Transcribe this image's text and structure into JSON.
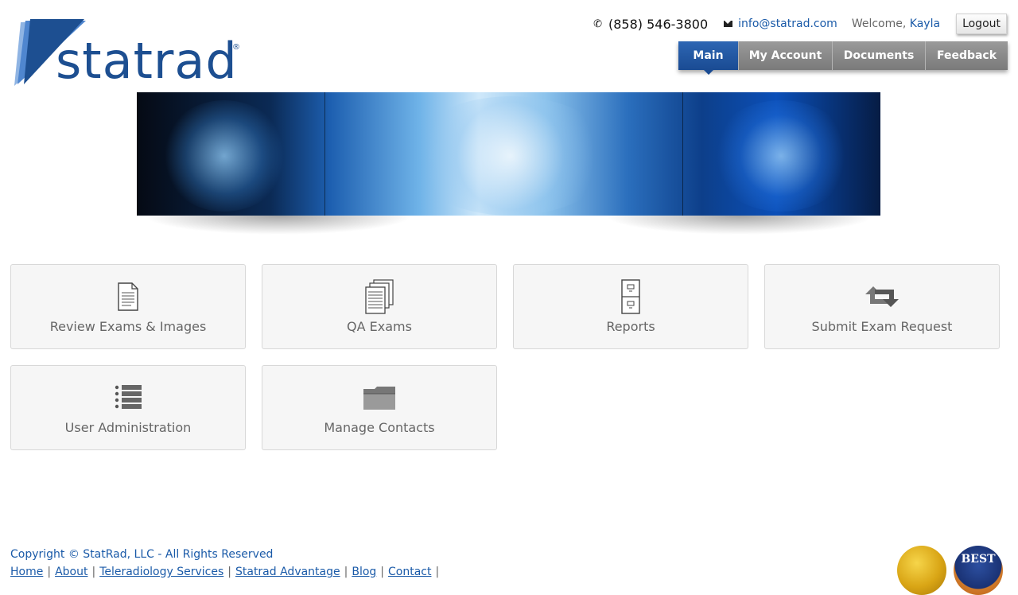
{
  "header": {
    "logo_text": "statrad",
    "logo_reg": "®",
    "phone": "(858) 546-3800",
    "email": "info@statrad.com",
    "welcome_prefix": "Welcome,",
    "user_name": "Kayla",
    "logout_label": "Logout"
  },
  "nav": {
    "tabs": [
      {
        "label": "Main",
        "active": true
      },
      {
        "label": "My Account"
      },
      {
        "label": "Documents"
      },
      {
        "label": "Feedback"
      }
    ]
  },
  "tiles": [
    {
      "label": "Review Exams & Images",
      "icon": "document-icon"
    },
    {
      "label": "QA Exams",
      "icon": "stacked-documents-icon"
    },
    {
      "label": "Reports",
      "icon": "file-cabinet-icon"
    },
    {
      "label": "Submit Exam Request",
      "icon": "exchange-arrows-icon"
    },
    {
      "label": "User Administration",
      "icon": "list-icon"
    },
    {
      "label": "Manage Contacts",
      "icon": "folder-icon"
    }
  ],
  "footer": {
    "copyright": "Copyright © StatRad, LLC - All Rights Reserved",
    "links": [
      "Home",
      "About",
      "Teleradiology Services",
      "Statrad Advantage",
      "Blog",
      "Contact"
    ],
    "badge_best": "BEST"
  },
  "colors": {
    "brand_blue": "#1d4f91",
    "nav_active": "#1a4b93",
    "nav_inactive": "#8a8a8a",
    "link": "#1a5aa8"
  }
}
